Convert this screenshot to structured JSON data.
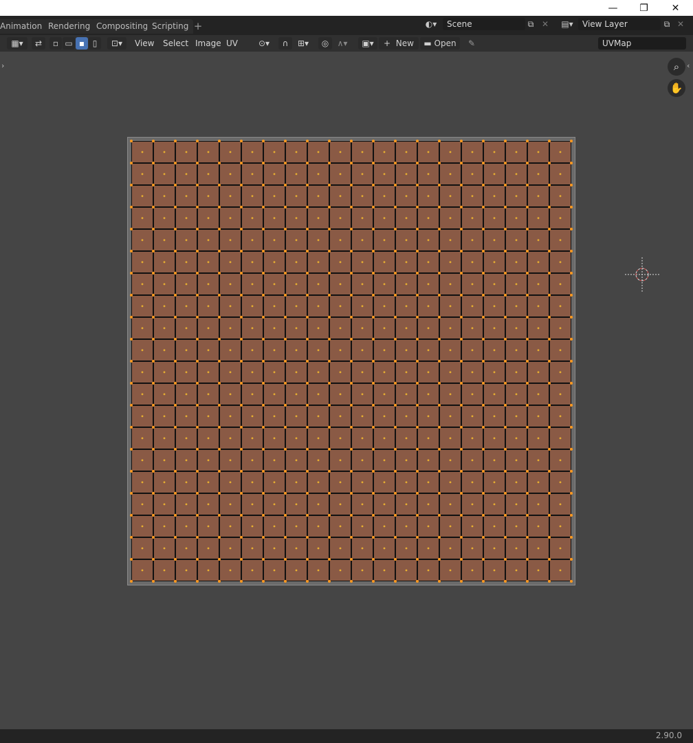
{
  "workspace_tabs": [
    "Animation",
    "Rendering",
    "Compositing",
    "Scripting"
  ],
  "add_workspace_label": "+",
  "scene": {
    "name": "Scene"
  },
  "view_layer": {
    "name": "View Layer"
  },
  "header": {
    "menus": [
      "View",
      "Select",
      "Image",
      "UV"
    ],
    "new_label": "New",
    "open_label": "Open",
    "uv_map_name": "UVMap"
  },
  "window_controls": {
    "minimize": "—",
    "maximize": "❐",
    "close": "✕"
  },
  "status": {
    "version": "2.90.0"
  },
  "uv_grid": {
    "columns": 20,
    "rows": 20
  },
  "colors": {
    "accent": "#4772b3",
    "uv_face": "#8a5a45",
    "uv_vertex": "#ff9a1f",
    "uv_edge": "#111111"
  }
}
